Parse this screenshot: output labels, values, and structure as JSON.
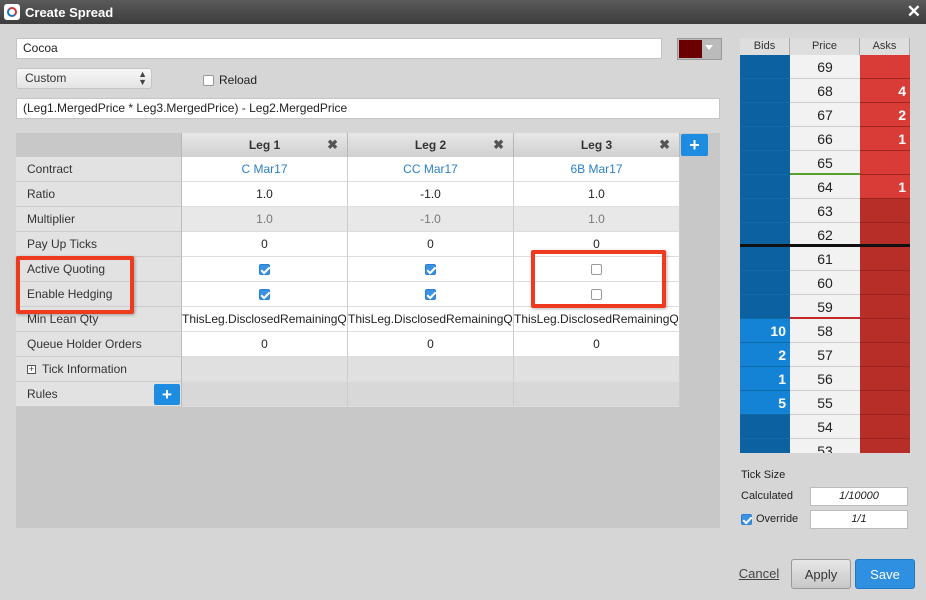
{
  "window": {
    "title": "Create Spread"
  },
  "spread_name": "Cocoa",
  "color": {
    "value": "#6b0000"
  },
  "mode_select": {
    "value": "Custom"
  },
  "reload_label": "Reload",
  "formula": "(Leg1.MergedPrice * Leg3.MergedPrice) - Leg2.MergedPrice",
  "legs": [
    {
      "header": "Leg 1",
      "contract": "C Mar17",
      "ratio": "1.0",
      "multiplier": "1.0",
      "payup": "0",
      "active_quoting": true,
      "enable_hedging": true,
      "min_lean": "ThisLeg.DisclosedRemainingQuantity",
      "queue_holder": "0"
    },
    {
      "header": "Leg 2",
      "contract": "CC Mar17",
      "ratio": "-1.0",
      "multiplier": "-1.0",
      "payup": "0",
      "active_quoting": true,
      "enable_hedging": true,
      "min_lean": "ThisLeg.DisclosedRemainingQuantity",
      "queue_holder": "0"
    },
    {
      "header": "Leg 3",
      "contract": "6B Mar17",
      "ratio": "1.0",
      "multiplier": "1.0",
      "payup": "0",
      "active_quoting": false,
      "enable_hedging": false,
      "min_lean": "ThisLeg.DisclosedRemainingQuantity",
      "queue_holder": "0"
    }
  ],
  "row_labels": {
    "contract": "Contract",
    "ratio": "Ratio",
    "multiplier": "Multiplier",
    "payup": "Pay Up Ticks",
    "active_quoting": "Active Quoting",
    "enable_hedging": "Enable Hedging",
    "min_lean": "Min Lean Qty",
    "queue_holder": "Queue Holder Orders",
    "tick_info": "Tick Information",
    "rules": "Rules"
  },
  "ladder": {
    "headers": {
      "bids": "Bids",
      "price": "Price",
      "asks": "Asks"
    },
    "rows": [
      {
        "price": "69",
        "bid": "",
        "ask": ""
      },
      {
        "price": "68",
        "bid": "",
        "ask": "4"
      },
      {
        "price": "67",
        "bid": "",
        "ask": "2"
      },
      {
        "price": "66",
        "bid": "",
        "ask": "1"
      },
      {
        "price": "65",
        "bid": "",
        "ask": ""
      },
      {
        "price": "64",
        "bid": "",
        "ask": "1"
      },
      {
        "price": "63",
        "bid": "",
        "ask": ""
      },
      {
        "price": "62",
        "bid": "",
        "ask": ""
      },
      {
        "price": "61",
        "bid": "",
        "ask": ""
      },
      {
        "price": "60",
        "bid": "",
        "ask": ""
      },
      {
        "price": "59",
        "bid": "",
        "ask": ""
      },
      {
        "price": "58",
        "bid": "10",
        "ask": ""
      },
      {
        "price": "57",
        "bid": "2",
        "ask": ""
      },
      {
        "price": "56",
        "bid": "1",
        "ask": ""
      },
      {
        "price": "55",
        "bid": "5",
        "ask": ""
      },
      {
        "price": "54",
        "bid": "",
        "ask": ""
      },
      {
        "price": "53",
        "bid": "",
        "ask": ""
      }
    ]
  },
  "tick_size": {
    "title": "Tick Size",
    "calculated_label": "Calculated",
    "calculated_value": "1/10000",
    "override_label": "Override",
    "override_checked": true,
    "override_value": "1/1"
  },
  "buttons": {
    "cancel": "Cancel",
    "apply": "Apply",
    "save": "Save"
  },
  "colors": {
    "bid_strong": "#0a72b8",
    "bid_dark": "#0c62a0",
    "ask_strong": "#d93c36",
    "ask_dark": "#b72d28",
    "accent": "#1e8ce0",
    "highlight": "#ee3a1f"
  }
}
